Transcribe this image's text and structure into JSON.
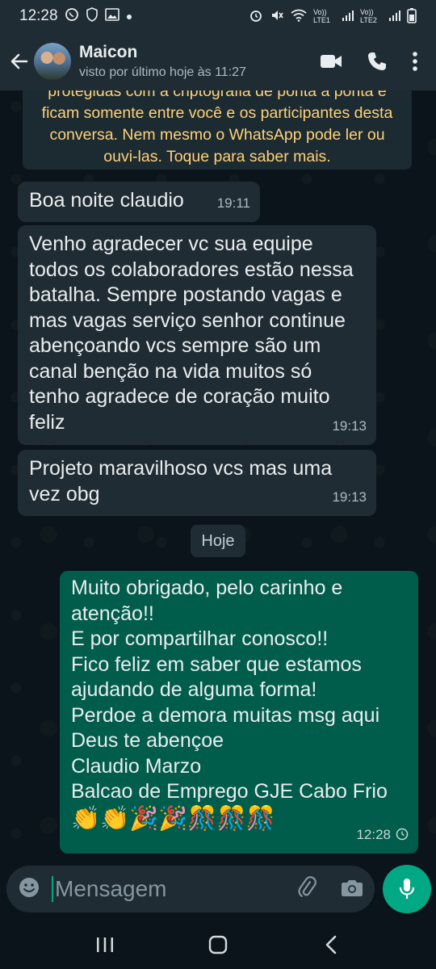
{
  "status_bar": {
    "time": "12:28",
    "carrier1": "Vo)) LTE1",
    "carrier2": "Vo)) LTE2"
  },
  "header": {
    "contact_name": "Maicon",
    "last_seen": "visto por último hoje às 11:27"
  },
  "encryption_notice": {
    "text": "protegidas com a criptografia de ponta a ponta e ficam somente entre você e os participantes desta conversa. Nem mesmo o WhatsApp pode ler ou ouvi-las. Toque para saber mais."
  },
  "messages": [
    {
      "direction": "in",
      "text": "Boa noite claudio",
      "time": "19:11"
    },
    {
      "direction": "in",
      "text": "Venho agradecer vc sua equipe todos os colaboradores estão nessa batalha. Sempre postando vagas e mas vagas serviço senhor continue abençoando vcs sempre são um canal benção na vida muitos só tenho agradece de coração muito feliz",
      "time": "19:13"
    },
    {
      "direction": "in",
      "text": "Projeto maravilhoso vcs mas uma vez obg",
      "time": "19:13"
    },
    {
      "direction": "out",
      "lines": [
        "Muito obrigado, pelo carinho e",
        "atenção!!",
        "E por compartilhar conosco!!",
        "Fico feliz em saber que estamos",
        "ajudando de alguma forma!",
        "Perdoe a demora muitas msg aqui",
        "Deus te abençoe",
        "Claudio Marzo",
        "Balcao de Emprego GJE Cabo Frio"
      ],
      "emojis": "👏👏🎉🎉🎊🎊🎊",
      "time": "12:28"
    }
  ],
  "day_separator": "Hoje",
  "composer": {
    "placeholder": "Mensagem"
  },
  "colors": {
    "incoming_bubble": "#202c33",
    "outgoing_bubble": "#005c4b",
    "accent": "#00a884",
    "notice_text": "#ffd279"
  }
}
